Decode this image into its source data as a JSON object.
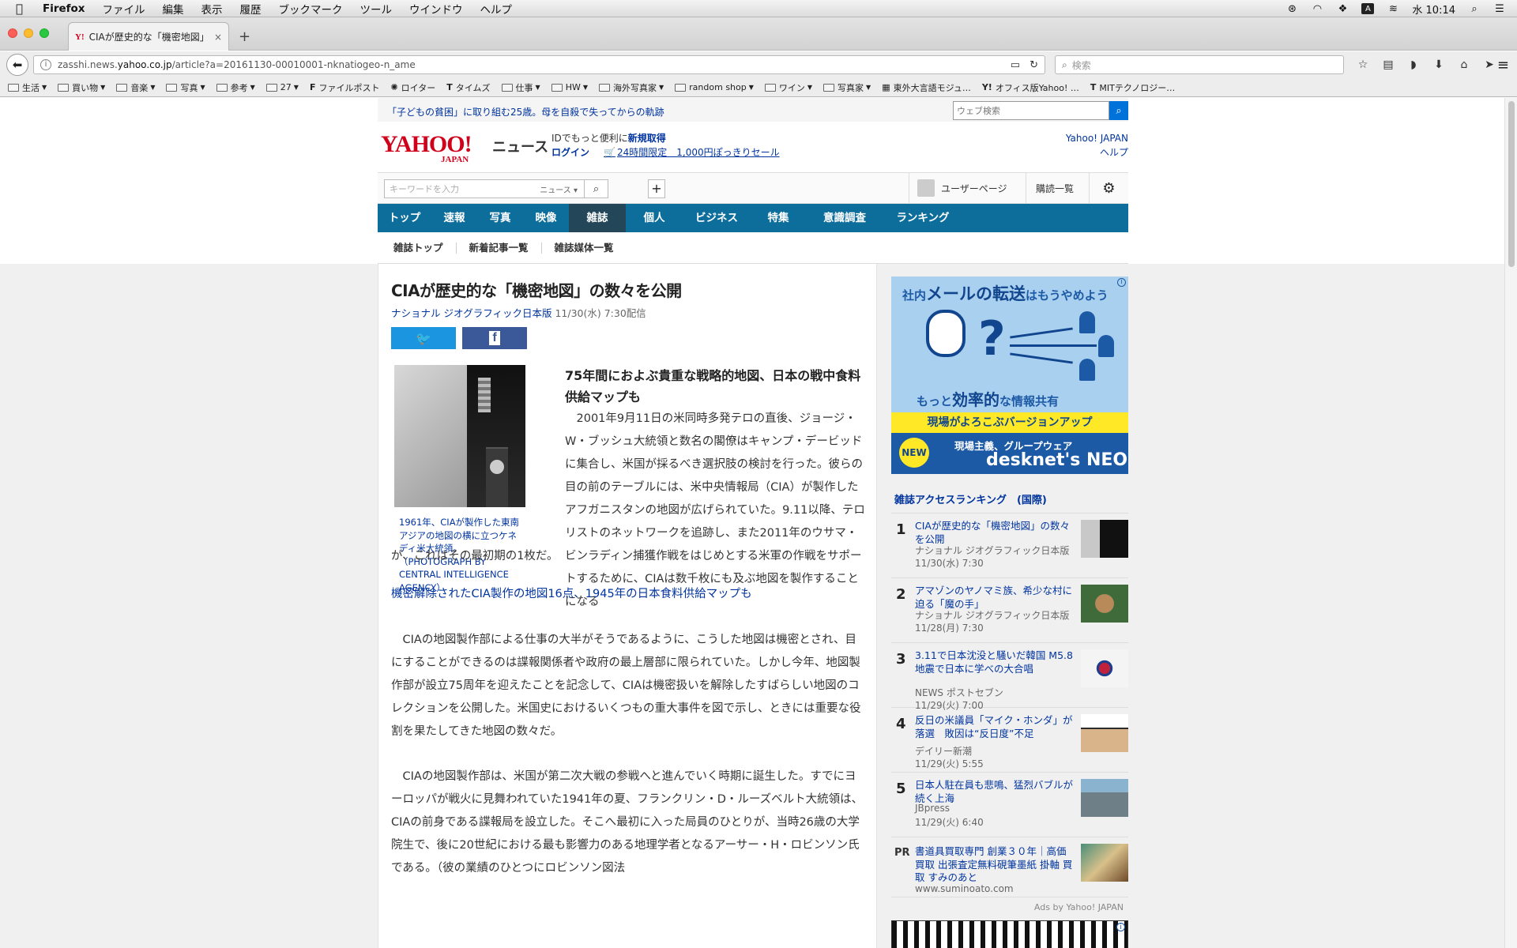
{
  "menubar": {
    "app": "Firefox",
    "items": [
      "ファイル",
      "編集",
      "表示",
      "履歴",
      "ブックマーク",
      "ツール",
      "ウインドウ",
      "ヘルプ"
    ],
    "clock": "水 10:14"
  },
  "browser": {
    "tab_title": "CIAが歴史的な「機密地図」…",
    "tab_favicon": "Y!",
    "url_host": "zasshi.news.",
    "url_domain": "yahoo.co.jp",
    "url_path": "/article?a=20161130-00010001-nknatiogeo-n_ame",
    "search_placeholder": "検索"
  },
  "bookmarks": [
    {
      "label": "生活",
      "type": "folder"
    },
    {
      "label": "買い物",
      "type": "folder"
    },
    {
      "label": "音楽",
      "type": "folder"
    },
    {
      "label": "写真",
      "type": "folder"
    },
    {
      "label": "参考",
      "type": "folder"
    },
    {
      "label": "27",
      "type": "folder"
    },
    {
      "label": "ファイルポスト",
      "type": "site",
      "icon": "F"
    },
    {
      "label": "ロイター",
      "type": "site",
      "icon": "✺"
    },
    {
      "label": "タイムズ",
      "type": "site",
      "icon": "T"
    },
    {
      "label": "仕事",
      "type": "folder"
    },
    {
      "label": "HW",
      "type": "folder"
    },
    {
      "label": "海外写真家",
      "type": "folder"
    },
    {
      "label": "random shop",
      "type": "folder"
    },
    {
      "label": "ワイン",
      "type": "folder"
    },
    {
      "label": "写真家",
      "type": "folder"
    },
    {
      "label": "東外大言語モジュ…",
      "type": "site",
      "icon": "▦"
    },
    {
      "label": "オフィス版Yahoo! …",
      "type": "site",
      "icon": "Y!"
    },
    {
      "label": "MITテクノロジー…",
      "type": "site",
      "icon": "T"
    }
  ],
  "page": {
    "notice": "「子どもの貧困」に取り組む25歳。母を自殺で失ってからの軌跡",
    "web_search_placeholder": "ウェブ検索",
    "logo_text": "YAHOO!",
    "logo_sub": "JAPAN",
    "logo_news": "ニュース",
    "id_line_prefix": "IDでもっと便利に",
    "id_register": "新規取得",
    "id_login": "ログイン",
    "id_sale": "24時間限定　1,000円ぽっきりセール",
    "yahoo_japan": "Yahoo! JAPAN",
    "help": "ヘルプ",
    "keyword_placeholder": "キーワードを入力",
    "keyword_scope": "ニュース ▾",
    "user_page": "ユーザーページ",
    "subscriptions": "購読一覧",
    "gnav": [
      "トップ",
      "速報",
      "写真",
      "映像",
      "雑誌",
      "個人",
      "ビジネス",
      "特集",
      "意識調査",
      "ランキング"
    ],
    "gnav_active": 4,
    "subnav": [
      "雑誌トップ",
      "新着記事一覧",
      "雑誌媒体一覧"
    ]
  },
  "article": {
    "title": "CIAが歴史的な「機密地図」の数々を公開",
    "source": "ナショナル ジオグラフィック日本版",
    "date": "11/30(水) 7:30配信",
    "caption": "1961年、CIAが製作した東南アジアの地図の横に立つケネディ米大統領。（PHOTOGRAPH BY CENTRAL INTELLIGENCE AGENCY）",
    "lead_heading": "75年間におよぶ貴重な戦略的地図、日本の戦中食料供給マップも",
    "p1_a": "　2001年9月11日の米同時多発テロの直後、ジョージ・W・ブッシュ大統領と数名の閣僚はキャンプ・デービッドに集合し、米国が採るべき選択肢の検討を行った。彼らの目の前のテーブルには、米中央情報局（CIA）が製作したアフガニスタンの地図が広げられていた。9.11以降、テロリストのネットワークを追跡し、また2011年のウサマ・ビンラディン捕獲作戦をはじめとする米軍の作戦をサポートするために、CIAは数千枚にも及ぶ地図を製作することになる",
    "p1_b": "が、これはその最初期の1枚だ。",
    "link": "機密解除されたCIA製作の地図16点、1945年の日本食料供給マップも",
    "p2": "　CIAの地図製作部による仕事の大半がそうであるように、こうした地図は機密とされ、目にすることができるのは諜報関係者や政府の最上層部に限られていた。しかし今年、地図製作部が設立75周年を迎えたことを記念して、CIAは機密扱いを解除したすばらしい地図のコレクションを公開した。米国史におけるいくつもの重大事件を図で示し、ときには重要な役割を果たしてきた地図の数々だ。",
    "p3": "　CIAの地図製作部は、米国が第二次大戦の参戦へと進んでいく時期に誕生した。すでにヨーロッパが戦火に見舞われていた1941年の夏、フランクリン・D・ルーズベルト大統領は、CIAの前身である諜報局を設立した。そこへ最初に入った局員のひとりが、当時26歳の大学院生で、後に20世紀における最も影響力のある地理学者となるアーサー・H・ロビンソン氏である。（彼の業績のひとつにロビンソン図法"
  },
  "ad": {
    "line1_a": "社内",
    "line1_b": "メールの転送",
    "line1_c": "はもうやめよう",
    "line2_a": "もっと",
    "line2_b": "効率的",
    "line2_c": "な情報共有",
    "band": "現場がよろこぶバージョンアップ",
    "new": "NEW",
    "brand_sub": "現場主義、グループウェア",
    "brand": "desknet's NEO"
  },
  "ranking": {
    "title": "雑誌アクセスランキング　(国際)",
    "items": [
      {
        "rank": "1",
        "title": "CIAが歴史的な「機密地図」の数々を公開",
        "source": "ナショナル ジオグラフィック日本版",
        "date": "11/30(水) 7:30"
      },
      {
        "rank": "2",
        "title": "アマゾンのヤノマミ族、希少な村に迫る「魔の手」",
        "source": "ナショナル ジオグラフィック日本版",
        "date": "11/28(月) 7:30"
      },
      {
        "rank": "3",
        "title": "3.11で日本沈没と騒いだ韓国 M5.8地震で日本に学べの大合唱",
        "source": "NEWS ポストセブン",
        "date": "11/29(火) 7:00"
      },
      {
        "rank": "4",
        "title": "反日の米議員「マイク・ホンダ」が落選　敗因は“反日度”不足",
        "source": "デイリー新潮",
        "date": "11/29(火) 5:55"
      },
      {
        "rank": "5",
        "title": "日本人駐在員も悲鳴、猛烈バブルが続く上海",
        "source": "JBpress",
        "date": "11/29(火) 6:40"
      }
    ],
    "pr_tag": "PR",
    "pr_title": "書道具買取専門 創業３０年｜高価買取 出張査定無料硯筆墨紙 掛軸 買取 すみのあと",
    "pr_url": "www.suminoato.com",
    "ads_by": "Ads by Yahoo! JAPAN"
  },
  "colors": {
    "link": "#00349f",
    "gnav": "#0d6e9b",
    "gnav_active": "#234759",
    "yahoo_red": "#d0021b",
    "twitter": "#1b95e0",
    "facebook": "#3b5998"
  }
}
